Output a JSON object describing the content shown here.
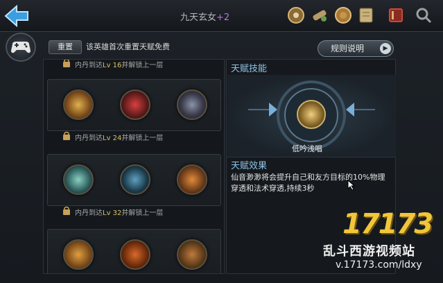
{
  "header": {
    "hero_name": "九天玄女",
    "hero_bonus": "+2"
  },
  "toolbar": {
    "reset_label": "重置",
    "reset_note": "该英雄首次重置天赋免费",
    "rules_label": "规则说明"
  },
  "tiers": [
    {
      "unlock_text": "内丹到达",
      "lv_text": "Lv 16",
      "suffix": "并解锁上一层"
    },
    {
      "unlock_text": "内丹到达",
      "lv_text": "Lv 24",
      "suffix": "并解锁上一层"
    },
    {
      "unlock_text": "内丹到达",
      "lv_text": "Lv 32",
      "suffix": "并解锁上一层"
    }
  ],
  "detail": {
    "skill_title": "天赋技能",
    "skill_name": "低吟浅唱",
    "effect_title": "天赋效果",
    "effect_text": "仙音渺渺将会提升自己和友方目标的10%物理穿透和法术穿透,持续3秒"
  },
  "watermark": {
    "logo": "17173",
    "line1": "乱斗西游视频站",
    "line2": "v.17173.com/ldxy"
  },
  "colors": {
    "accent_blue": "#8fc3e8",
    "level_gold": "#d8c26a",
    "watermark_gold": "#f2c63a",
    "bonus_purple": "#b07ad8"
  }
}
